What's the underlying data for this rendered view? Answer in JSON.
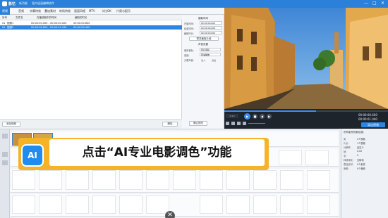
{
  "titlebar": {
    "app_name": "影忆",
    "sub1": "新功能",
    "sub2": "强大极速编辑软件",
    "min": "—",
    "max": "□",
    "close": "✕"
  },
  "menu": [
    "视频",
    "音频",
    "字幕特效",
    "叠加素材",
    "转场特效",
    "画面风格",
    "MTV",
    "卡拉OK",
    "片尾与配乐"
  ],
  "list": {
    "headers": [
      "序号",
      "文件名",
      "在播放器中的时间",
      "截取的时长"
    ],
    "rows": [
      {
        "idx": "01",
        "name": "视频1",
        "range": "00:00:00.000 - 00:00:00.000",
        "dur": "00:00:00.600"
      },
      {
        "idx": "02",
        "name": "视频2",
        "range": "00:00:00.600 - 00:00:01.040",
        "dur": "00:00:00.440"
      }
    ],
    "add_button": "添加视频",
    "delete_button": "删除",
    "confirm_button": "确认修改"
  },
  "settings": {
    "section1": "截取时间",
    "start_label": "开始时间:",
    "start_val": "00:00:00.000",
    "end_label": "结束时间:",
    "end_val": "00:00:00.600",
    "dur_label": "截取时长:",
    "dur_val": "00:00:00.600",
    "preview_button": "预览截取片段",
    "section2": "声音设置",
    "vol_label": "使用音轨:",
    "vol_val": "原片音轨",
    "speed_label": "音速:",
    "speed_val": "原速播放",
    "fade_label": "头尾声音:",
    "fade_in": "淡入",
    "fade_out": "淡出"
  },
  "player": {
    "time_current": "00:00:00.600",
    "time_total": "00:00:01.040",
    "export_button": "导出视频"
  },
  "props": {
    "title": "所有制作的新信息:",
    "rows": [
      [
        "类",
        "2个视频"
      ],
      [
        "片长:",
        "1个视频"
      ],
      [
        "分辨率:",
        "自定义"
      ],
      [
        "帧:",
        "0.00"
      ],
      [
        "字:",
        "0"
      ],
      [
        "转场特效:",
        "无转场"
      ],
      [
        "叠加素材:",
        "0个素材"
      ],
      [
        "音频:",
        "0个音频"
      ]
    ]
  },
  "overlay": {
    "text": "点击“AI专业电影调色”功能",
    "icon_text": "AI"
  },
  "close_symbol": "✕",
  "colors": {
    "accent": "#2b80d9",
    "overlay_border": "#f5b32a"
  }
}
